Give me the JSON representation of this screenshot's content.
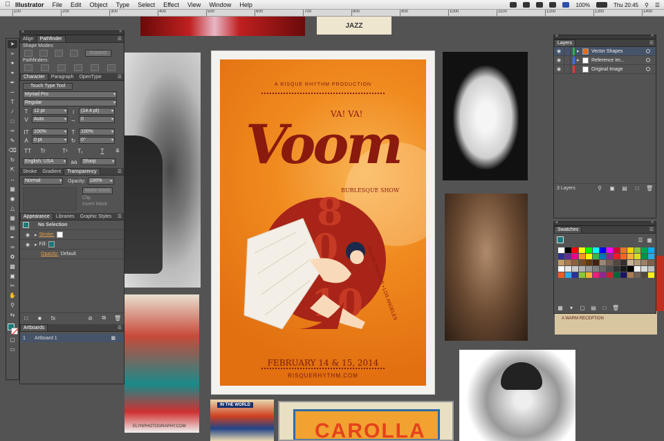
{
  "menubar": {
    "app_name": "Illustrator",
    "menus": [
      "File",
      "Edit",
      "Object",
      "Type",
      "Select",
      "Effect",
      "View",
      "Window",
      "Help"
    ],
    "battery": "100%",
    "clock": "Thu 20:45"
  },
  "ruler": {
    "ticks": [
      "100",
      "200",
      "300",
      "400",
      "500",
      "600",
      "700",
      "800",
      "900",
      "1000",
      "1100",
      "1200",
      "1300",
      "1400"
    ]
  },
  "pathfinder_panel": {
    "tabs": [
      "Align",
      "Pathfinder"
    ],
    "shape_modes_label": "Shape Modes:",
    "expand_label": "Expand",
    "pathfinders_label": "Pathfinders:"
  },
  "character_panel": {
    "tabs": [
      "Character",
      "Paragraph",
      "OpenType"
    ],
    "touch_type_label": "Touch Type Tool",
    "font_family": "Myriad Pro",
    "font_style": "Regular",
    "font_size": "12 pt",
    "leading": "(14.4 pt)",
    "kerning": "Auto",
    "tracking": "0",
    "vertical_scale": "100%",
    "horizontal_scale": "100%",
    "baseline_shift": "0 pt",
    "rotation": "0°",
    "language": "English: USA",
    "antialias": "Sharp",
    "type_buttons": [
      "TT",
      "Tr",
      "T¹",
      "T₁",
      "T",
      "T"
    ]
  },
  "transparency_panel": {
    "tabs": [
      "Stroke",
      "Gradient",
      "Transparency"
    ],
    "blend_mode": "Normal",
    "opacity_label": "Opacity:",
    "opacity_value": "100%",
    "make_mask_label": "Make Mask",
    "clip_label": "Clip",
    "invert_mask_label": "Invert Mask"
  },
  "appearance_panel": {
    "tabs": [
      "Appearance",
      "Libraries",
      "Graphic Styles"
    ],
    "selection": "No Selection",
    "stroke_label": "Stroke:",
    "fill_label": "Fill:",
    "opacity_label": "Opacity:",
    "opacity_value": "Default"
  },
  "artboards_panel": {
    "tab": "Artboards",
    "items": [
      {
        "index": "1",
        "name": "Artboard 1"
      }
    ]
  },
  "layers_panel": {
    "tab": "Layers",
    "layers": [
      {
        "name": "Vector Shapes",
        "color": "#29b34a",
        "selected": true
      },
      {
        "name": "Reference Im...",
        "color": "#3a6ef0",
        "selected": false
      },
      {
        "name": "Original Image",
        "color": "#e03a3a",
        "selected": false
      }
    ],
    "count": "3 Layers"
  },
  "swatches_panel": {
    "tab": "Swatches",
    "colors": [
      "#ffffff",
      "#000000",
      "#ff0000",
      "#ffff00",
      "#00ff00",
      "#00ffff",
      "#0000ff",
      "#ff00ff",
      "#c8102e",
      "#e97424",
      "#ffd200",
      "#8dc63f",
      "#00a651",
      "#00aeef",
      "#2e3192",
      "#662d91",
      "#ec008c",
      "#f7941d",
      "#fff200",
      "#39b54a",
      "#0072bc",
      "#92278f",
      "#ed1c24",
      "#f26522",
      "#fbaf3f",
      "#d7df23",
      "#009444",
      "#27aae1",
      "#c69c6d",
      "#a67c52",
      "#8c6239",
      "#754c24",
      "#603813",
      "#42210b",
      "#998675",
      "#736357",
      "#534741",
      "#362f2d",
      "#c7b299",
      "#b59a7a",
      "#9e8064",
      "#806048",
      "#ffffff",
      "#e6e6e6",
      "#cccccc",
      "#b3b3b3",
      "#999999",
      "#808080",
      "#666666",
      "#4d4d4d",
      "#333333",
      "#1a1a1a",
      "#000000",
      "#f2f2f2",
      "#d9d9d9",
      "#bfbfbf",
      "#f15a24",
      "#29abe2",
      "#2e3192",
      "#8cc63f",
      "#fbb03b",
      "#ed1e79",
      "#93278f",
      "#c1272d",
      "#006837",
      "#1b1464",
      "#a67c52",
      "#736357",
      "#534741",
      "#fcee21"
    ]
  },
  "poster": {
    "production": "A RISQUE RHYTHM PRODUCTION",
    "tagline": "VA! VA!",
    "title": "Voom",
    "subtitle": "BURLESQUE SHOW",
    "num_top": "8",
    "num_mid": "30",
    "num_bot": "10",
    "venue": "NUOVA THEATRE • LOS ANGELES",
    "dates": "FEBRUARY 14 & 15, 2014",
    "website": "RISQUERHYTHM.COM"
  },
  "reference_images": {
    "jazz_label": "JAZZ",
    "photo_caption": "ELYNPHOTOGRAPHY.COM",
    "world_badge": "IN THE WORLD",
    "marquee_text": "CAROLLA",
    "sign_text": "A WARM RECEPTION"
  }
}
